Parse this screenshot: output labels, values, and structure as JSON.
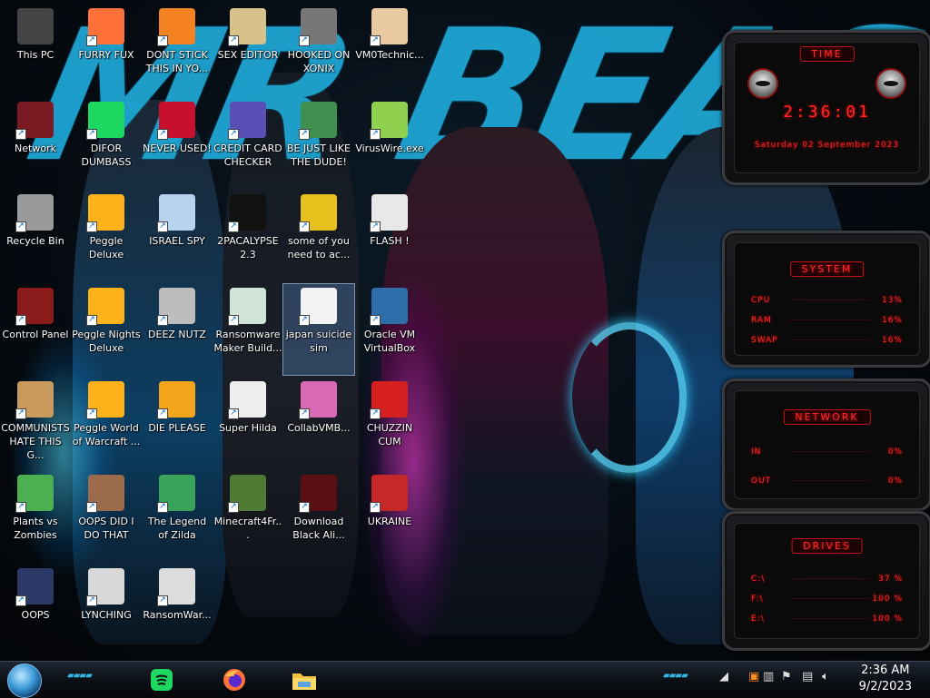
{
  "desktop": {
    "icons": [
      {
        "label": "This PC",
        "icon": "computer-icon"
      },
      {
        "label": "FURRY FUX",
        "icon": "firefox-icon"
      },
      {
        "label": "DONT STICK THIS IN YO...",
        "icon": "vlc-cone-icon"
      },
      {
        "label": "SEX EDITOR",
        "icon": "hxd-icon"
      },
      {
        "label": "HOOKED ON XONIX",
        "icon": "xonix-icon"
      },
      {
        "label": "VM0Technic...",
        "icon": "doctor-icon"
      },
      {
        "label": "Network",
        "icon": "network-icon"
      },
      {
        "label": "DIFOR DUMBASS",
        "icon": "spotify-icon"
      },
      {
        "label": "NEVER USED!",
        "icon": "devcpp-icon"
      },
      {
        "label": "CREDIT CARD CHECKER",
        "icon": "credit-card-icon"
      },
      {
        "label": "BE JUST LIKE THE DUDE!",
        "icon": "santa-icon"
      },
      {
        "label": "VirusWire.exe",
        "icon": "lime-icon"
      },
      {
        "label": "Recycle Bin",
        "icon": "recycle-bin-icon"
      },
      {
        "label": "Peggle Deluxe",
        "icon": "peggle-icon"
      },
      {
        "label": "ISRAEL SPY",
        "icon": "spy-cam-icon"
      },
      {
        "label": "2PACALYPSE 2.3",
        "icon": "terminal-icon"
      },
      {
        "label": "some of you need to ac...",
        "icon": "beaver-icon"
      },
      {
        "label": "FLASH !",
        "icon": "flash-icon"
      },
      {
        "label": "Control Panel",
        "icon": "control-panel-icon"
      },
      {
        "label": "Peggle Nights Deluxe",
        "icon": "peggle-icon"
      },
      {
        "label": "DEEZ NUTZ",
        "icon": "windows-stack-icon"
      },
      {
        "label": "Ransomware Maker Build...",
        "icon": "window-app-icon"
      },
      {
        "label": "japan suicide sim",
        "icon": "document-icon"
      },
      {
        "label": "Oracle VM VirtualBox",
        "icon": "virtualbox-icon"
      },
      {
        "label": "COMMUNISTS HATE THIS G...",
        "icon": "money-bag-icon"
      },
      {
        "label": "Peggle World of Warcraft ...",
        "icon": "peggle-icon"
      },
      {
        "label": "DIE PLEASE",
        "icon": "de-icon"
      },
      {
        "label": "Super Hilda",
        "icon": "pixel-cat-icon"
      },
      {
        "label": "CollabVMB...",
        "icon": "monitor-icon"
      },
      {
        "label": "CHUZZIN CUM",
        "icon": "chuzzle-icon"
      },
      {
        "label": "Plants vs Zombies",
        "icon": "plant-icon"
      },
      {
        "label": "OOPS DID I DO THAT",
        "icon": "portrait-icon"
      },
      {
        "label": "The Legend of Zilda",
        "icon": "pixel-hero-icon"
      },
      {
        "label": "Minecraft4Fr...",
        "icon": "minecraft-icon"
      },
      {
        "label": "Download Black Ali...",
        "icon": "alien-icon"
      },
      {
        "label": "UKRAINE",
        "icon": "radiation-icon"
      },
      {
        "label": "OOPS",
        "icon": "frame-icon"
      },
      {
        "label": "LYNCHING",
        "icon": "ornament-icon"
      },
      {
        "label": "RansomWar...",
        "icon": "skull-icon"
      }
    ]
  },
  "gadgets": {
    "time": {
      "title": "TIME",
      "clock": "2:36:01",
      "date": "Saturday 02 September 2023"
    },
    "system": {
      "title": "SYSTEM",
      "rows": [
        {
          "label": "CPU",
          "value": "13%"
        },
        {
          "label": "RAM",
          "value": "16%"
        },
        {
          "label": "SWAP",
          "value": "16%"
        }
      ]
    },
    "network": {
      "title": "NETWORK",
      "rows": [
        {
          "label": "IN",
          "value": "0%"
        },
        {
          "label": "OUT",
          "value": "0%"
        }
      ]
    },
    "drives": {
      "title": "DRIVES",
      "rows": [
        {
          "label": "C:\\",
          "value": "37 %"
        },
        {
          "label": "F:\\",
          "value": "100 %"
        },
        {
          "label": "E:\\",
          "value": "100 %"
        }
      ]
    }
  },
  "taskbar": {
    "pinned": [
      {
        "name": "spotify-icon"
      },
      {
        "name": "firefox-icon"
      },
      {
        "name": "file-explorer-icon"
      }
    ],
    "clock_time": "2:36 AM",
    "clock_date": "9/2/2023"
  },
  "colors": {
    "gadget_red": "#ff2626",
    "taskbar_accent": "#37b7e6",
    "wallpaper_cyan": "#1fa9d8"
  }
}
